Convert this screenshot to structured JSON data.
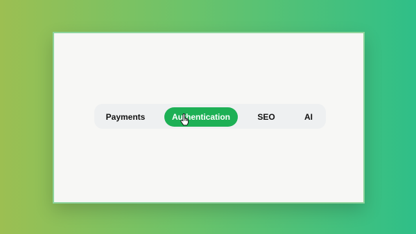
{
  "tabs": [
    {
      "label": "Payments",
      "active": false
    },
    {
      "label": "Authentication",
      "active": true
    },
    {
      "label": "SEO",
      "active": false
    },
    {
      "label": "AI",
      "active": false
    }
  ],
  "colors": {
    "active_tab": "#1db055",
    "panel": "#f7f7f5",
    "tabbar": "#eef0f1"
  },
  "icons": {
    "cursor": "hand-pointer-icon"
  }
}
